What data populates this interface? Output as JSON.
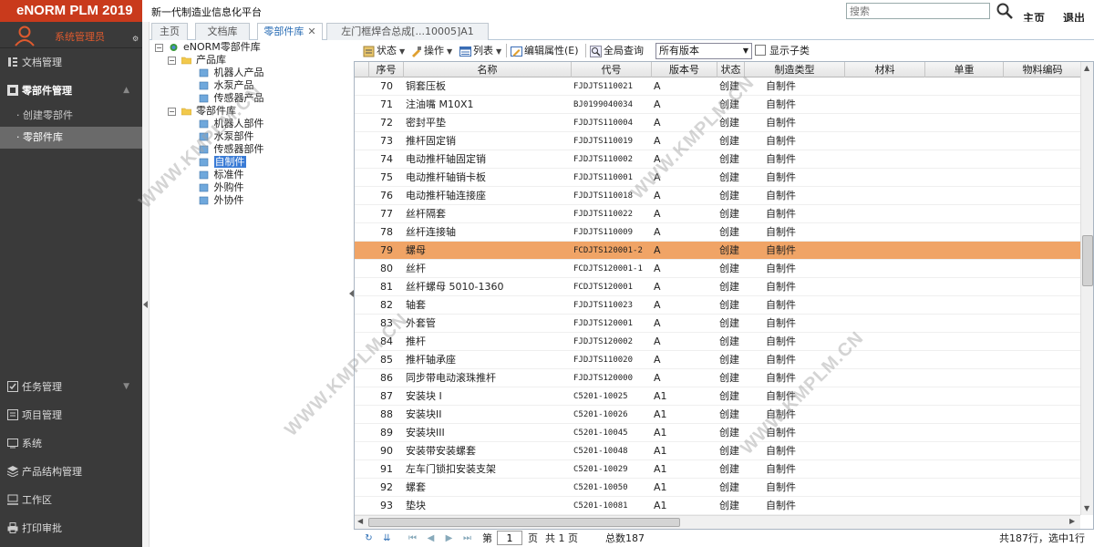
{
  "header": {
    "logo": "eNORM PLM 2019",
    "app_title": "新一代制造业信息化平台",
    "search_placeholder": "搜索",
    "home_link": "主页",
    "logout_link": "退出"
  },
  "sidebar": {
    "user": "系统管理员",
    "top_items": [
      {
        "label": "文档管理",
        "icon": "document-icon"
      },
      {
        "label": "零部件管理",
        "icon": "parts-icon"
      }
    ],
    "sub_items": [
      "· 创建零部件",
      "· 零部件库"
    ],
    "bottom_items": [
      {
        "label": "任务管理",
        "icon": "task-icon"
      },
      {
        "label": "项目管理",
        "icon": "project-icon"
      },
      {
        "label": "系统",
        "icon": "system-icon"
      },
      {
        "label": "产品结构管理",
        "icon": "structure-icon"
      },
      {
        "label": "工作区",
        "icon": "workspace-icon"
      },
      {
        "label": "打印审批",
        "icon": "print-icon"
      }
    ]
  },
  "tabs": [
    "主页",
    "文档库",
    "零部件库",
    "左门框焊合总成[...10005]A1"
  ],
  "tree": {
    "root": "eNORM零部件库",
    "product_lib": "产品库",
    "product_children": [
      "机器人产品",
      "水泵产品",
      "传感器产品"
    ],
    "part_lib": "零部件库",
    "part_children": [
      "机器人部件",
      "水泵部件",
      "传感器部件",
      "自制件",
      "标准件",
      "外购件",
      "外协件"
    ]
  },
  "toolbar": {
    "status": "状态",
    "operate": "操作",
    "list": "列表",
    "edit_props": "编辑属性(E)",
    "global_query": "全局查询",
    "version_select": "所有版本",
    "show_subclass": "显示子类"
  },
  "table": {
    "columns": [
      "序号",
      "名称",
      "代号",
      "版本号",
      "状态",
      "制造类型",
      "材料",
      "单重",
      "物料编码"
    ],
    "rows": [
      [
        "70",
        "铜套压板",
        "FJDJTS110021",
        "A",
        "创建",
        "自制件"
      ],
      [
        "71",
        "注油嘴 M10X1",
        "BJ0199040034",
        "A",
        "创建",
        "自制件"
      ],
      [
        "72",
        "密封平垫",
        "FJDJTS110004",
        "A",
        "创建",
        "自制件"
      ],
      [
        "73",
        "推杆固定销",
        "FJDJTS110019",
        "A",
        "创建",
        "自制件"
      ],
      [
        "74",
        "电动推杆轴固定销",
        "FJDJTS110002",
        "A",
        "创建",
        "自制件"
      ],
      [
        "75",
        "电动推杆轴销卡板",
        "FJDJTS110001",
        "A",
        "创建",
        "自制件"
      ],
      [
        "76",
        "电动推杆轴连接座",
        "FJDJTS110018",
        "A",
        "创建",
        "自制件"
      ],
      [
        "77",
        "丝杆隔套",
        "FJDJTS110022",
        "A",
        "创建",
        "自制件"
      ],
      [
        "78",
        "丝杆连接轴",
        "FJDJTS110009",
        "A",
        "创建",
        "自制件"
      ],
      [
        "79",
        "螺母",
        "FCDJTS120001-2",
        "A",
        "创建",
        "自制件"
      ],
      [
        "80",
        "丝杆",
        "FCDJTS120001-1",
        "A",
        "创建",
        "自制件"
      ],
      [
        "81",
        "丝杆螺母 5010-1360",
        "FCDJTS120001",
        "A",
        "创建",
        "自制件"
      ],
      [
        "82",
        "轴套",
        "FJDJTS110023",
        "A",
        "创建",
        "自制件"
      ],
      [
        "83",
        "外套管",
        "FJDJTS120001",
        "A",
        "创建",
        "自制件"
      ],
      [
        "84",
        "推杆",
        "FJDJTS120002",
        "A",
        "创建",
        "自制件"
      ],
      [
        "85",
        "推杆轴承座",
        "FJDJTS110020",
        "A",
        "创建",
        "自制件"
      ],
      [
        "86",
        "同步带电动滚珠推杆",
        "FJDJTS120000",
        "A",
        "创建",
        "自制件"
      ],
      [
        "87",
        "安装块 I",
        "C5201-10025",
        "A1",
        "创建",
        "自制件"
      ],
      [
        "88",
        "安装块II",
        "C5201-10026",
        "A1",
        "创建",
        "自制件"
      ],
      [
        "89",
        "安装块III",
        "C5201-10045",
        "A1",
        "创建",
        "自制件"
      ],
      [
        "90",
        "安装带安装螺套",
        "C5201-10048",
        "A1",
        "创建",
        "自制件"
      ],
      [
        "91",
        "左车门锁扣安装支架",
        "C5201-10029",
        "A1",
        "创建",
        "自制件"
      ],
      [
        "92",
        "螺套",
        "C5201-10050",
        "A1",
        "创建",
        "自制件"
      ],
      [
        "93",
        "垫块",
        "C5201-10081",
        "A1",
        "创建",
        "自制件"
      ]
    ],
    "selected_row_index": 9,
    "selected_color": "#f0a466"
  },
  "pager": {
    "page_prefix": "第",
    "page_value": "1",
    "page_suffix": "页",
    "total_pages": "共 1 页",
    "total_count": "总数187",
    "summary": "共187行，选中1行"
  },
  "watermark": "WWW.KMPLM.CN",
  "colors": {
    "brand": "#c93a1c",
    "sidebar_bg": "#3a3a3a",
    "accent_blue": "#2a6db5",
    "user_orange": "#e05a2e"
  }
}
